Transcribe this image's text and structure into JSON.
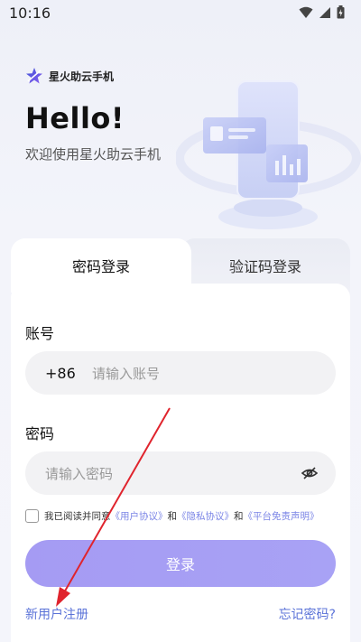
{
  "status_bar": {
    "time": "10:16"
  },
  "brand": {
    "name": "星火助云手机"
  },
  "header": {
    "hello": "Hello!",
    "welcome": "欢迎使用星火助云手机"
  },
  "tabs": [
    {
      "label": "密码登录",
      "active": true
    },
    {
      "label": "验证码登录",
      "active": false
    }
  ],
  "form": {
    "account_label": "账号",
    "country_code": "+86",
    "account_placeholder": "请输入账号",
    "password_label": "密码",
    "password_placeholder": "请输入密码"
  },
  "agreement": {
    "prefix": "我已阅读并同意",
    "user_agreement": "《用户协议》",
    "and1": "和",
    "privacy_agreement": "《隐私协议》",
    "and2": "和",
    "disclaimer": "《平台免责声明》",
    "checked": false
  },
  "login_button": "登录",
  "register_link": "新用户注册",
  "forgot_link": "忘记密码?",
  "colors": {
    "accent": "#a59bf3",
    "link": "#5b73d8",
    "annotation_arrow": "#e0242d"
  }
}
